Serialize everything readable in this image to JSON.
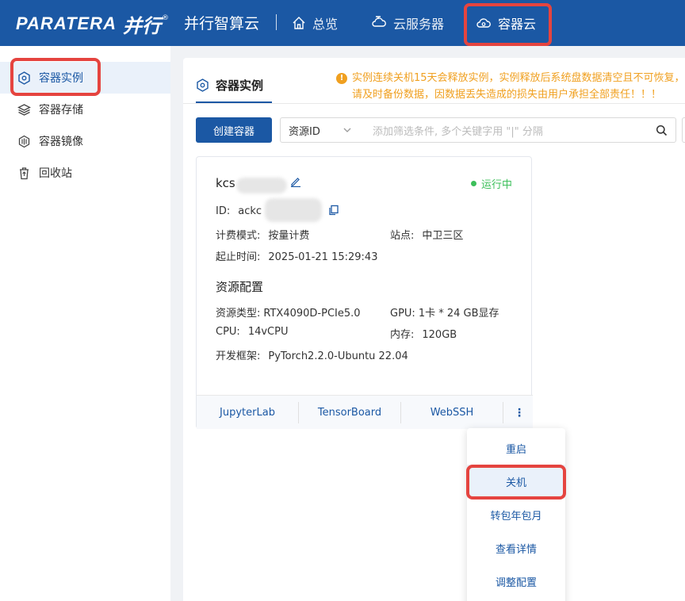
{
  "brand": {
    "logo_latin": "PARATERA",
    "logo_cn": "并行",
    "logo_reg": "®",
    "app_title": "并行智算云"
  },
  "topnav": {
    "overview": "总览",
    "cloud_server": "云服务器",
    "container_cloud": "容器云"
  },
  "sidebar": {
    "items": [
      {
        "label": "容器实例",
        "icon": "container-instance-icon",
        "active": true
      },
      {
        "label": "容器存储",
        "icon": "layers-icon",
        "active": false
      },
      {
        "label": "容器镜像",
        "icon": "image-stack-icon",
        "active": false
      },
      {
        "label": "回收站",
        "icon": "trash-icon",
        "active": false
      }
    ]
  },
  "main": {
    "tab_label": "容器实例",
    "warning": "实例连续关机15天会释放实例，实例释放后系统盘数据清空且不可恢复，请及时备份数据，因数据丢失造成的损失由用户承担全部责任！！！",
    "create_button": "创建容器",
    "filter": {
      "key": "资源ID",
      "placeholder": "添加筛选条件, 多个关键字用 \"|\" 分隔"
    }
  },
  "card": {
    "name": "kcs",
    "status": "运行中",
    "id_label": "ID:",
    "id_value": "ackc",
    "billing_label": "计费模式:",
    "billing_value": "按量计费",
    "site_label": "站点:",
    "site_value": "中卫三区",
    "time_label": "起止时间:",
    "time_value": "2025-01-21 15:29:43",
    "resource_title": "资源配置",
    "type_label": "资源类型:",
    "type_value": "RTX4090D-PCIe5.0",
    "gpu_label": "GPU:",
    "gpu_value": "1卡 * 24 GB显存",
    "cpu_label": "CPU:",
    "cpu_value": "14vCPU",
    "mem_label": "内存:",
    "mem_value": "120GB",
    "framework_label": "开发框架:",
    "framework_value": "PyTorch2.2.0-Ubuntu 22.04",
    "actions": [
      "JupyterLab",
      "TensorBoard",
      "WebSSH"
    ],
    "more": "⋮"
  },
  "menu": {
    "items": [
      "重启",
      "关机",
      "转包年包月",
      "查看详情",
      "调整配置"
    ]
  },
  "colors": {
    "brand_blue": "#1b58a4",
    "highlight_red": "#e5443f",
    "warning_orange": "#f0a020",
    "running_green": "#3cbf5a"
  }
}
